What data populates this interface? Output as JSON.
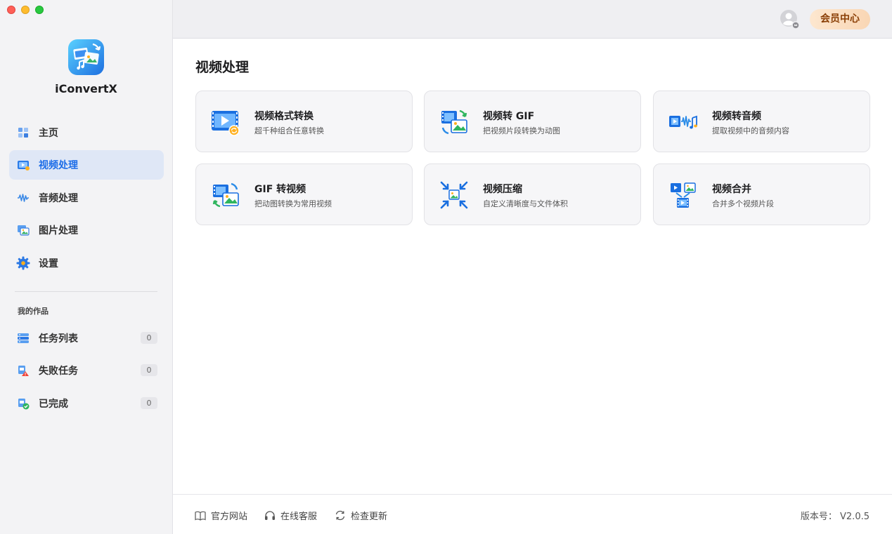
{
  "app": {
    "name": "iConvertX"
  },
  "sidebar": {
    "items": [
      {
        "label": "主页",
        "icon": "home-grid-icon"
      },
      {
        "label": "视频处理",
        "icon": "video-icon"
      },
      {
        "label": "音频处理",
        "icon": "audio-wave-icon"
      },
      {
        "label": "图片处理",
        "icon": "image-icon"
      },
      {
        "label": "设置",
        "icon": "gear-icon"
      }
    ],
    "section_title": "我的作品",
    "works": [
      {
        "label": "任务列表",
        "count": "0",
        "icon": "task-list-icon"
      },
      {
        "label": "失败任务",
        "count": "0",
        "icon": "failed-task-icon"
      },
      {
        "label": "已完成",
        "count": "0",
        "icon": "completed-icon"
      }
    ],
    "active_index": 1
  },
  "header": {
    "vip_label": "会员中心"
  },
  "main": {
    "title": "视频处理",
    "cards": [
      {
        "title": "视频格式转换",
        "desc": "超千种组合任意转换",
        "icon": "video-convert-icon"
      },
      {
        "title": "视频转 GIF",
        "desc": "把视频片段转换为动图",
        "icon": "video-to-gif-icon"
      },
      {
        "title": "视频转音频",
        "desc": "提取视频中的音频内容",
        "icon": "video-to-audio-icon"
      },
      {
        "title": "GIF 转视频",
        "desc": "把动图转换为常用视频",
        "icon": "gif-to-video-icon"
      },
      {
        "title": "视频压缩",
        "desc": "自定义清晰度与文件体积",
        "icon": "compress-icon"
      },
      {
        "title": "视频合并",
        "desc": "合并多个视频片段",
        "icon": "merge-icon"
      }
    ]
  },
  "footer": {
    "links": [
      {
        "label": "官方网站",
        "icon": "book-icon"
      },
      {
        "label": "在线客服",
        "icon": "headset-icon"
      },
      {
        "label": "检查更新",
        "icon": "refresh-icon"
      }
    ],
    "version": "版本号： V2.0.5"
  },
  "colors": {
    "accent": "#1e6ee8",
    "active_bg": "#dfe7f6",
    "vip_text": "#8a3f06"
  }
}
